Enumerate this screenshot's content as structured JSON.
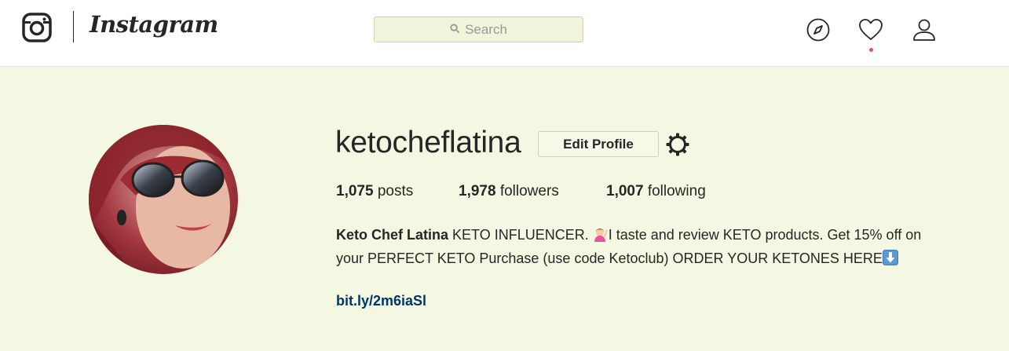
{
  "header": {
    "brand": "Instagram",
    "search_placeholder": "Search",
    "icons": [
      "instagram-glyph-icon",
      "compass-icon",
      "heart-icon",
      "person-icon"
    ],
    "notification_dot_color": "#ed4956"
  },
  "profile": {
    "username": "ketocheflatina",
    "edit_profile_label": "Edit Profile",
    "stats": {
      "posts_count": "1,075",
      "posts_label": "posts",
      "followers_count": "1,978",
      "followers_label": "followers",
      "following_count": "1,007",
      "following_label": "following"
    },
    "bio": {
      "full_name": "Keto Chef Latina",
      "text_part1": " KETO INFLUENCER. ",
      "text_part2": "I taste and review KETO products. Get 15% off on your PERFECT KETO Purchase (use code Ketoclub) ORDER YOUR KETONES HERE",
      "emojis": [
        "person-raising-hand-icon",
        "down-arrow-icon"
      ]
    },
    "link": "bit.ly/2m6iaSl"
  },
  "colors": {
    "page_background": "#f4f7e1",
    "link": "#003569"
  }
}
